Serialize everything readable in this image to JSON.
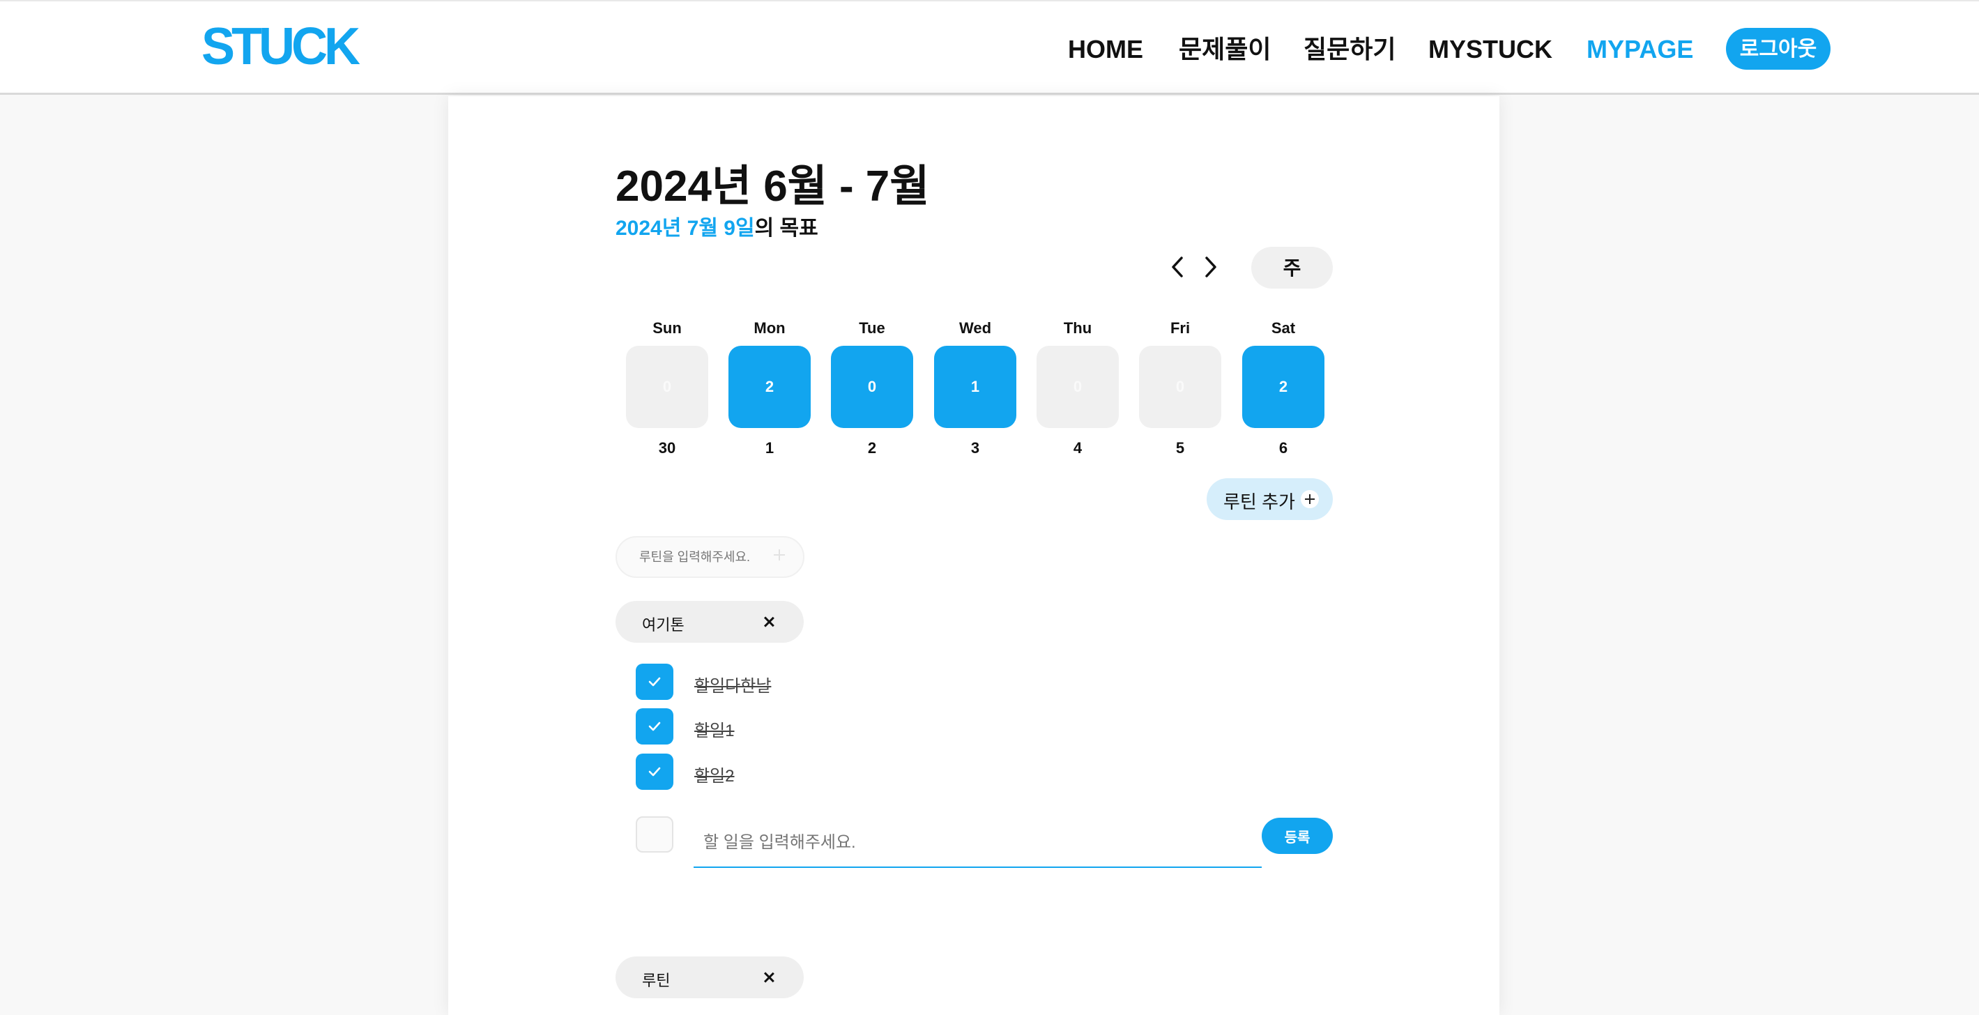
{
  "header": {
    "logo": "STUCK",
    "nav": [
      "HOME",
      "문제풀이",
      "질문하기",
      "MYSTUCK",
      "MYPAGE"
    ],
    "active_nav": "MYPAGE",
    "logout_label": "로그아웃"
  },
  "calendar": {
    "title": "2024년 6월 - 7월",
    "goal_date": "2024년 7월 9일",
    "goal_suffix": "의 목표",
    "view_label": "주",
    "days": [
      {
        "name": "Sun",
        "count": "0",
        "date": "30",
        "active": false
      },
      {
        "name": "Mon",
        "count": "2",
        "date": "1",
        "active": true
      },
      {
        "name": "Tue",
        "count": "0",
        "date": "2",
        "active": true
      },
      {
        "name": "Wed",
        "count": "1",
        "date": "3",
        "active": true
      },
      {
        "name": "Thu",
        "count": "0",
        "date": "4",
        "active": false
      },
      {
        "name": "Fri",
        "count": "0",
        "date": "5",
        "active": false
      },
      {
        "name": "Sat",
        "count": "2",
        "date": "6",
        "active": true
      }
    ]
  },
  "routine": {
    "add_label": "루틴 추가",
    "input_placeholder": "루틴을 입력해주세요.",
    "routines": [
      {
        "name": "여기톤"
      },
      {
        "name": "루틴"
      }
    ]
  },
  "todos": {
    "items": [
      {
        "text": "할일다한날",
        "done": true
      },
      {
        "text": "할일1",
        "done": true
      },
      {
        "text": "할일2",
        "done": true
      }
    ],
    "input_placeholder": "할 일을 입력해주세요.",
    "register_label": "등록"
  },
  "colors": {
    "accent": "#12a5ef",
    "inactive_day": "#f0f0f0",
    "chip": "#efefef",
    "routine_add_bg": "#d6eefb"
  }
}
